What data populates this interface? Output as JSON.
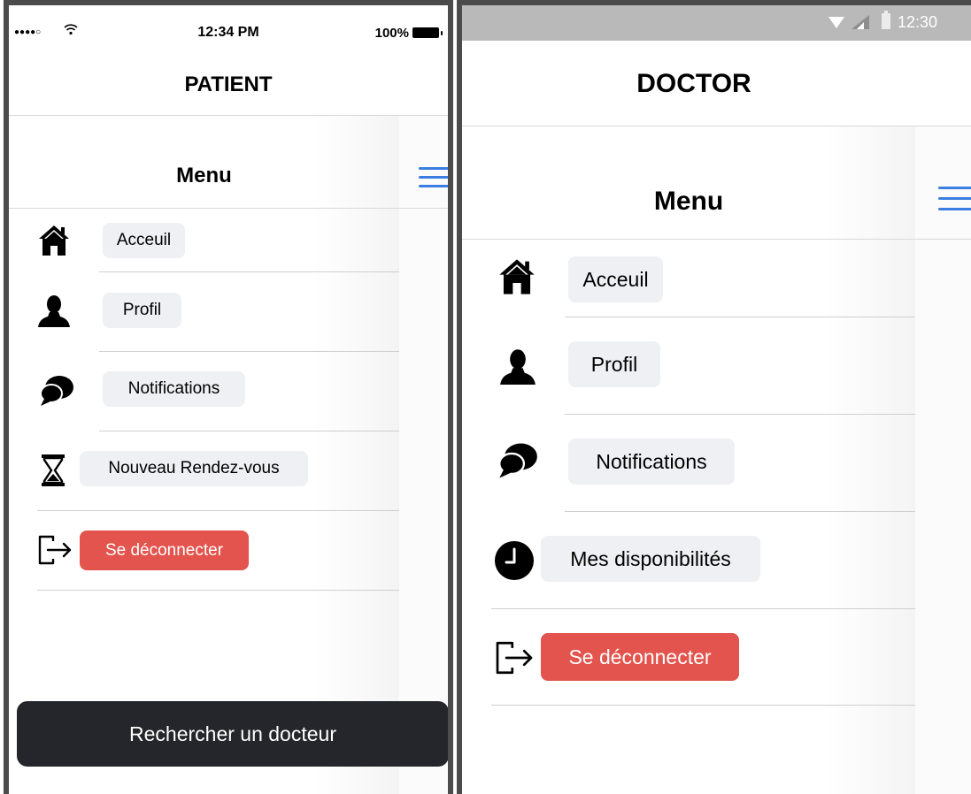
{
  "patient": {
    "status": {
      "signal": "●●●●○",
      "time": "12:34 PM",
      "battery": "100%"
    },
    "header_title": "PATIENT",
    "menu_title": "Menu",
    "items": [
      {
        "label": "Acceuil",
        "icon": "home-icon"
      },
      {
        "label": "Profil",
        "icon": "user-icon"
      },
      {
        "label": "Notifications",
        "icon": "chat-bubbles-icon"
      },
      {
        "label": "Nouveau Rendez-vous",
        "icon": "hourglass-icon"
      },
      {
        "label": "Se déconnecter",
        "icon": "logout-icon"
      }
    ],
    "search_button": "Rechercher un docteur"
  },
  "doctor": {
    "status": {
      "time": "12:30"
    },
    "header_title": "DOCTOR",
    "menu_title": "Menu",
    "items": [
      {
        "label": "Acceuil",
        "icon": "home-icon"
      },
      {
        "label": "Profil",
        "icon": "user-icon"
      },
      {
        "label": "Notifications",
        "icon": "chat-bubbles-icon"
      },
      {
        "label": "Mes disponibilités",
        "icon": "clock-icon"
      },
      {
        "label": "Se déconnecter",
        "icon": "logout-icon"
      }
    ]
  },
  "colors": {
    "accent": "#3b7de0",
    "logout": "#e2544d",
    "pill": "#eff0f3",
    "search_button": "#25262b"
  }
}
